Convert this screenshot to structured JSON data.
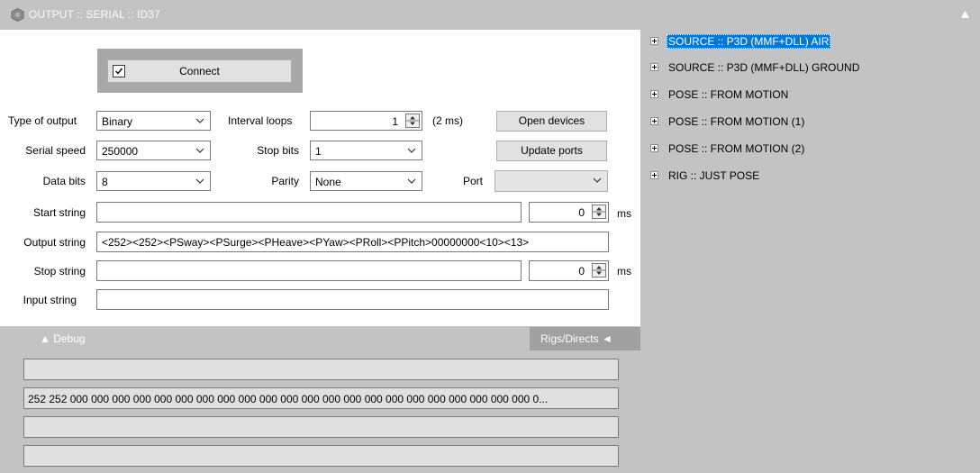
{
  "window": {
    "title": "OUTPUT :: SERIAL :: ID37"
  },
  "connect": {
    "label": "Connect",
    "checked": true
  },
  "fields": {
    "type_of_output": {
      "label": "Type of output",
      "value": "Binary"
    },
    "interval_loops": {
      "label": "Interval loops",
      "value": "1",
      "unit": "(2 ms)"
    },
    "serial_speed": {
      "label": "Serial speed",
      "value": "250000"
    },
    "stop_bits": {
      "label": "Stop bits",
      "value": "1"
    },
    "data_bits": {
      "label": "Data bits",
      "value": "8"
    },
    "parity": {
      "label": "Parity",
      "value": "None"
    },
    "port": {
      "label": "Port",
      "value": ""
    },
    "start_string": {
      "label": "Start string",
      "value": "",
      "delay": "0",
      "unit": "ms"
    },
    "output_string": {
      "label": "Output string",
      "value": "<252><252><PSway><PSurge><PHeave><PYaw><PRoll><PPitch>00000000<10><13>"
    },
    "stop_string": {
      "label": "Stop string",
      "value": "",
      "delay": "0",
      "unit": "ms"
    },
    "input_string": {
      "label": "Input string",
      "value": ""
    }
  },
  "buttons": {
    "open_devices": "Open devices",
    "update_ports": "Update ports"
  },
  "tabs": {
    "debug": "▲  Debug",
    "rigs_directs": "Rigs/Directs  ◄"
  },
  "debug": {
    "lines": [
      "",
      "252 252 000 000 000 000 000 000 000 000 000 000 000 000 000 000 000 000 000 000 000 000 000 000 0...",
      "",
      ""
    ]
  },
  "tree": {
    "items": [
      {
        "label": "SOURCE :: P3D (MMF+DLL) AIR",
        "selected": true
      },
      {
        "label": "SOURCE :: P3D (MMF+DLL) GROUND",
        "selected": false
      },
      {
        "label": "POSE :: FROM MOTION",
        "selected": false
      },
      {
        "label": "POSE :: FROM MOTION (1)",
        "selected": false
      },
      {
        "label": "POSE :: FROM MOTION (2)",
        "selected": false
      },
      {
        "label": "RIG :: JUST POSE",
        "selected": false
      }
    ]
  },
  "colors": {
    "panel": "#ffffff",
    "background": "#c3c3c3",
    "selection": "#0078d7"
  }
}
